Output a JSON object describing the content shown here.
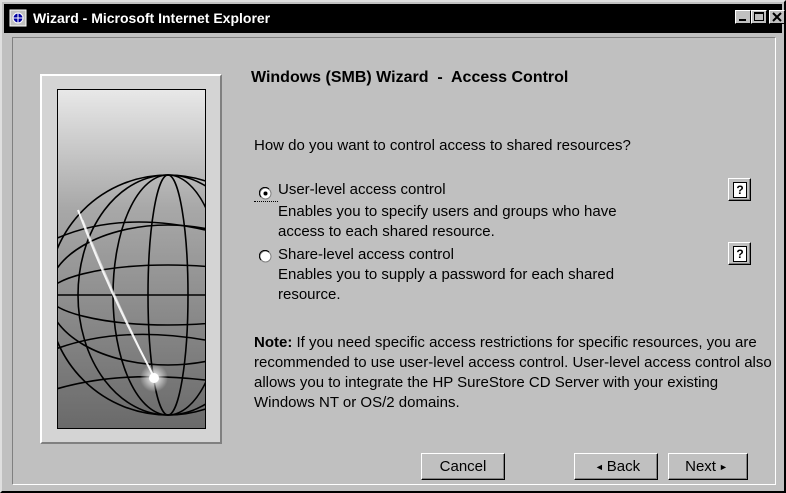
{
  "window": {
    "title": "Wizard - Microsoft Internet Explorer",
    "icon": "ie-wizard-icon"
  },
  "wizard": {
    "heading": "Windows (SMB) Wizard  -  Access Control",
    "question": "How do you want to control access to shared resources?",
    "options": [
      {
        "label": "User-level access control",
        "desc_line1": "Enables you to specify users and groups who have",
        "desc_line2": "access to each shared resource.",
        "selected": true
      },
      {
        "label": "Share-level access control",
        "desc_line1": "Enables you to supply a password for each shared",
        "desc_line2": "resource.",
        "selected": false
      }
    ],
    "help_glyph": "?",
    "note_label": "Note:",
    "note_text": " If you need specific access restrictions for specific resources, you are recommended to use user-level access control. User-level access control also allows you to integrate the HP SureStore CD Server with your existing Windows NT or OS/2 domains."
  },
  "buttons": {
    "cancel": "Cancel",
    "back": "Back",
    "next": "Next",
    "back_arrow": "◄",
    "next_arrow": "►"
  }
}
